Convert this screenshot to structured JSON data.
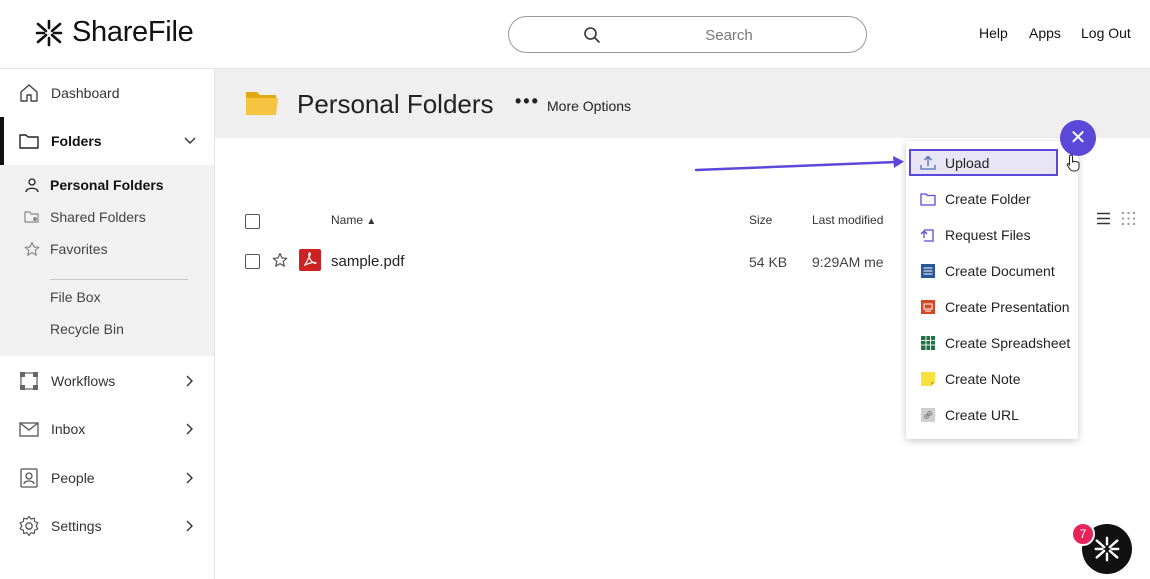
{
  "header": {
    "logo_text": "ShareFile",
    "search_placeholder": "Search",
    "links": {
      "help": "Help",
      "apps": "Apps",
      "logout": "Log Out"
    }
  },
  "sidebar": {
    "dashboard": "Dashboard",
    "folders": "Folders",
    "sub_items": {
      "personal": "Personal Folders",
      "shared": "Shared Folders",
      "favorites": "Favorites",
      "filebox": "File Box",
      "recycle": "Recycle Bin"
    },
    "workflows": "Workflows",
    "inbox": "Inbox",
    "people": "People",
    "settings": "Settings"
  },
  "main": {
    "title": "Personal Folders",
    "more_options": "More Options",
    "columns": {
      "name": "Name",
      "size": "Size",
      "modified": "Last modified"
    },
    "files": [
      {
        "name": "sample.pdf",
        "size": "54 KB",
        "modified": "9:29AM me"
      }
    ]
  },
  "menu": {
    "upload": "Upload",
    "create_folder": "Create Folder",
    "request_files": "Request Files",
    "create_document": "Create Document",
    "create_presentation": "Create Presentation",
    "create_spreadsheet": "Create Spreadsheet",
    "create_note": "Create Note",
    "create_url": "Create URL"
  },
  "notifications": {
    "count": "7"
  },
  "colors": {
    "accent": "#5b48d9",
    "badge": "#e6245a",
    "pdf": "#cc2222"
  }
}
